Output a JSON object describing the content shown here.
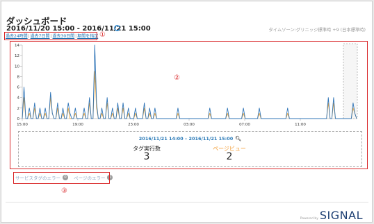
{
  "header": {
    "title": "ダッシュボード",
    "range": "2016/11/20 15:00 - 2016/11/21 15:00",
    "timezone": "タイムゾーン:グリニッジ標準時 +9 (日本標準時)",
    "quick_links": [
      "過去24時間",
      "過去7日間",
      "過去30日間",
      "期間を指定"
    ],
    "annotation_1": "①"
  },
  "colors": {
    "accent": "#1a6fb0",
    "series_blue": "#2f74b7",
    "series_orange": "#e9a33a",
    "annotation_red": "#d9282a"
  },
  "chart_data": {
    "type": "line",
    "yticks": [
      "0",
      "2",
      "4",
      "6",
      "8",
      "10",
      "12",
      "14"
    ],
    "ylim": [
      0,
      14
    ],
    "xticks": [
      "15:00",
      "19:00",
      "23:00",
      "03:00",
      "07:00",
      "11:00"
    ],
    "grid": false,
    "series": [
      {
        "color": "#2f74b7",
        "values": [
          0,
          6,
          0,
          0,
          2,
          0,
          0,
          3,
          0,
          0,
          2,
          0,
          0,
          2,
          0,
          0,
          5,
          1,
          0,
          0,
          3,
          0,
          0,
          2,
          0,
          0,
          3,
          1,
          0,
          0,
          2,
          0,
          0,
          0,
          0,
          2,
          0,
          0,
          4,
          0,
          0,
          14,
          3,
          0,
          0,
          2,
          0,
          0,
          4,
          0,
          0,
          2,
          0,
          0,
          3,
          0,
          0,
          3,
          0,
          0,
          2,
          0,
          0,
          0,
          2,
          0,
          0,
          0,
          0,
          3,
          0,
          0,
          2,
          0,
          0,
          2,
          0,
          0,
          0,
          0,
          0,
          0,
          0,
          0,
          0,
          0,
          0,
          0,
          2,
          0,
          0,
          0,
          0,
          0,
          0,
          0,
          0,
          0,
          0,
          0,
          0,
          0,
          0,
          0,
          0,
          0,
          2,
          0,
          0,
          0,
          0,
          0,
          0,
          0,
          0,
          0,
          2,
          0,
          0,
          0,
          0,
          0,
          0,
          0,
          0,
          2,
          0,
          0,
          0,
          0,
          0,
          0,
          0,
          0,
          2,
          0,
          0,
          0,
          0,
          0,
          0,
          0,
          0,
          0,
          0,
          0,
          0,
          0,
          0,
          0,
          2,
          0,
          0,
          0,
          0,
          0,
          0,
          0,
          0,
          0,
          0,
          0,
          0,
          0,
          0,
          0,
          0,
          0,
          0,
          0,
          0,
          0,
          0,
          4,
          0,
          0,
          4,
          0,
          0,
          0,
          0,
          0,
          0,
          0,
          0,
          0,
          0,
          3,
          1,
          0
        ]
      },
      {
        "color": "#e9a33a",
        "values": [
          0,
          4,
          0,
          0,
          1,
          0,
          0,
          2,
          0,
          0,
          1,
          0,
          0,
          1,
          0,
          0,
          4,
          1,
          0,
          0,
          2,
          0,
          0,
          1,
          0,
          0,
          2,
          0,
          0,
          0,
          1,
          0,
          0,
          0,
          0,
          1,
          0,
          0,
          3,
          0,
          0,
          9,
          2,
          0,
          0,
          1,
          0,
          0,
          3,
          0,
          0,
          1,
          0,
          0,
          2,
          0,
          0,
          2,
          0,
          0,
          1,
          0,
          0,
          0,
          1,
          0,
          0,
          0,
          0,
          2,
          0,
          0,
          1,
          0,
          0,
          1,
          0,
          0,
          0,
          0,
          0,
          0,
          0,
          0,
          0,
          0,
          0,
          0,
          1,
          0,
          0,
          0,
          0,
          0,
          0,
          0,
          0,
          0,
          0,
          0,
          0,
          0,
          0,
          0,
          0,
          0,
          1,
          0,
          0,
          0,
          0,
          0,
          0,
          0,
          0,
          0,
          1,
          0,
          0,
          0,
          0,
          0,
          0,
          0,
          0,
          1,
          0,
          0,
          0,
          0,
          0,
          0,
          0,
          0,
          1,
          0,
          0,
          0,
          0,
          0,
          0,
          0,
          0,
          0,
          0,
          0,
          0,
          0,
          0,
          0,
          1,
          0,
          0,
          0,
          0,
          0,
          0,
          0,
          0,
          0,
          0,
          0,
          0,
          0,
          0,
          0,
          0,
          0,
          0,
          0,
          0,
          0,
          0,
          3,
          0,
          0,
          3,
          0,
          0,
          0,
          0,
          0,
          0,
          0,
          0,
          0,
          0,
          2,
          1,
          0
        ]
      }
    ]
  },
  "annotation_2": "②",
  "summary": {
    "range": "2016/11/21 14:00 – 2016/11/21 15:00",
    "magnifier_icon": "search-icon",
    "metrics": [
      {
        "label": "タグ実行数",
        "value": "3"
      },
      {
        "label": "ページビュー",
        "value": "2"
      }
    ]
  },
  "errors": {
    "items": [
      {
        "label": "サービスタグのエラー",
        "count": "0"
      },
      {
        "label": "ページのエラー",
        "count": "0"
      }
    ],
    "annotation_3": "③"
  },
  "footer": {
    "powered_by": "Powered by",
    "logo": "SIGNAL"
  }
}
